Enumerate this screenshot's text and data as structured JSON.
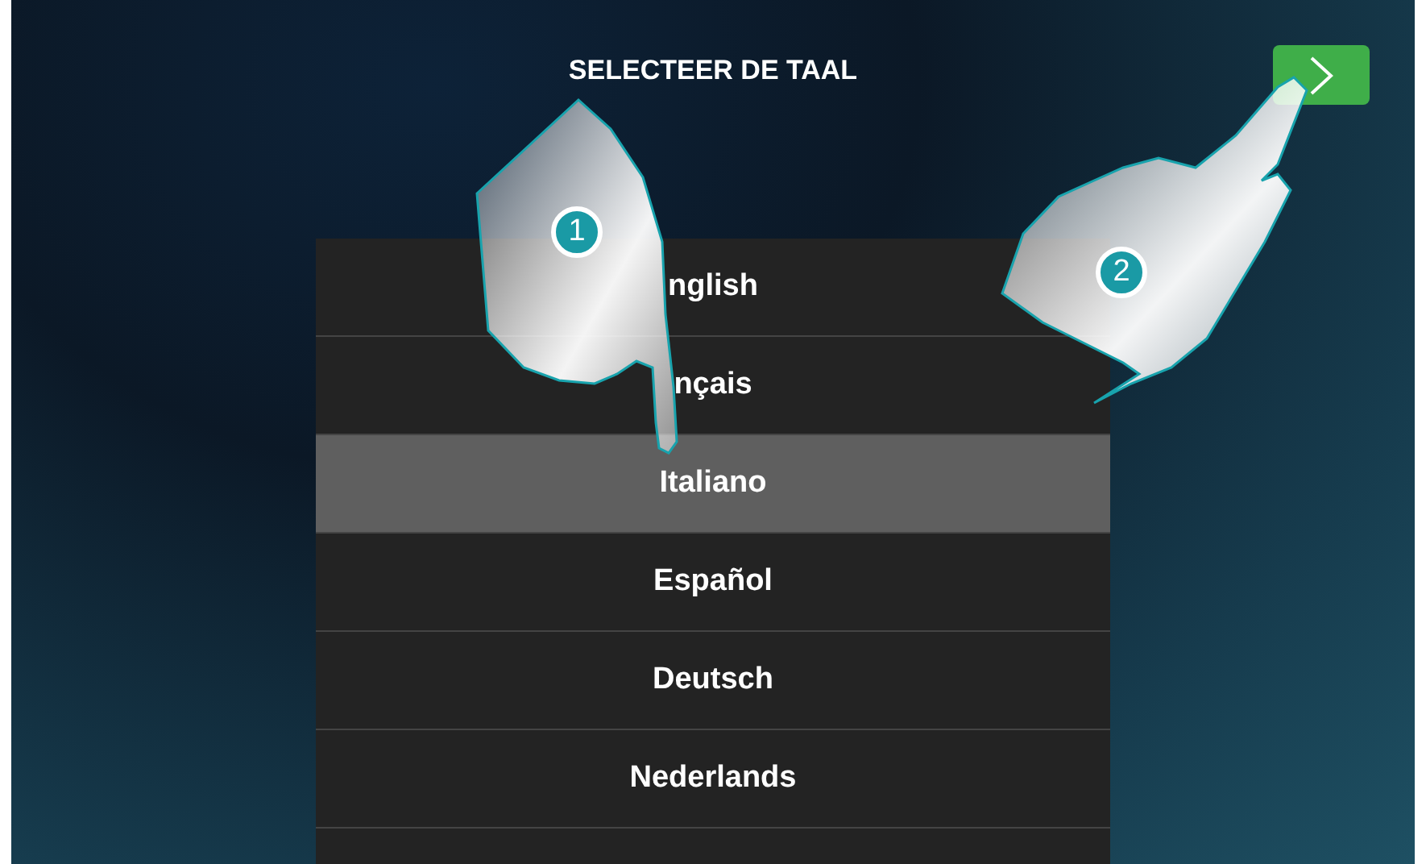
{
  "title": "SELECTEER DE TAAL",
  "languages": [
    {
      "label": "nglish",
      "selected": false
    },
    {
      "label": "nçais",
      "selected": false
    },
    {
      "label": "Italiano",
      "selected": true
    },
    {
      "label": "Español",
      "selected": false
    },
    {
      "label": "Deutsch",
      "selected": false
    },
    {
      "label": "Nederlands",
      "selected": false
    }
  ],
  "callouts": [
    "1",
    "2"
  ]
}
